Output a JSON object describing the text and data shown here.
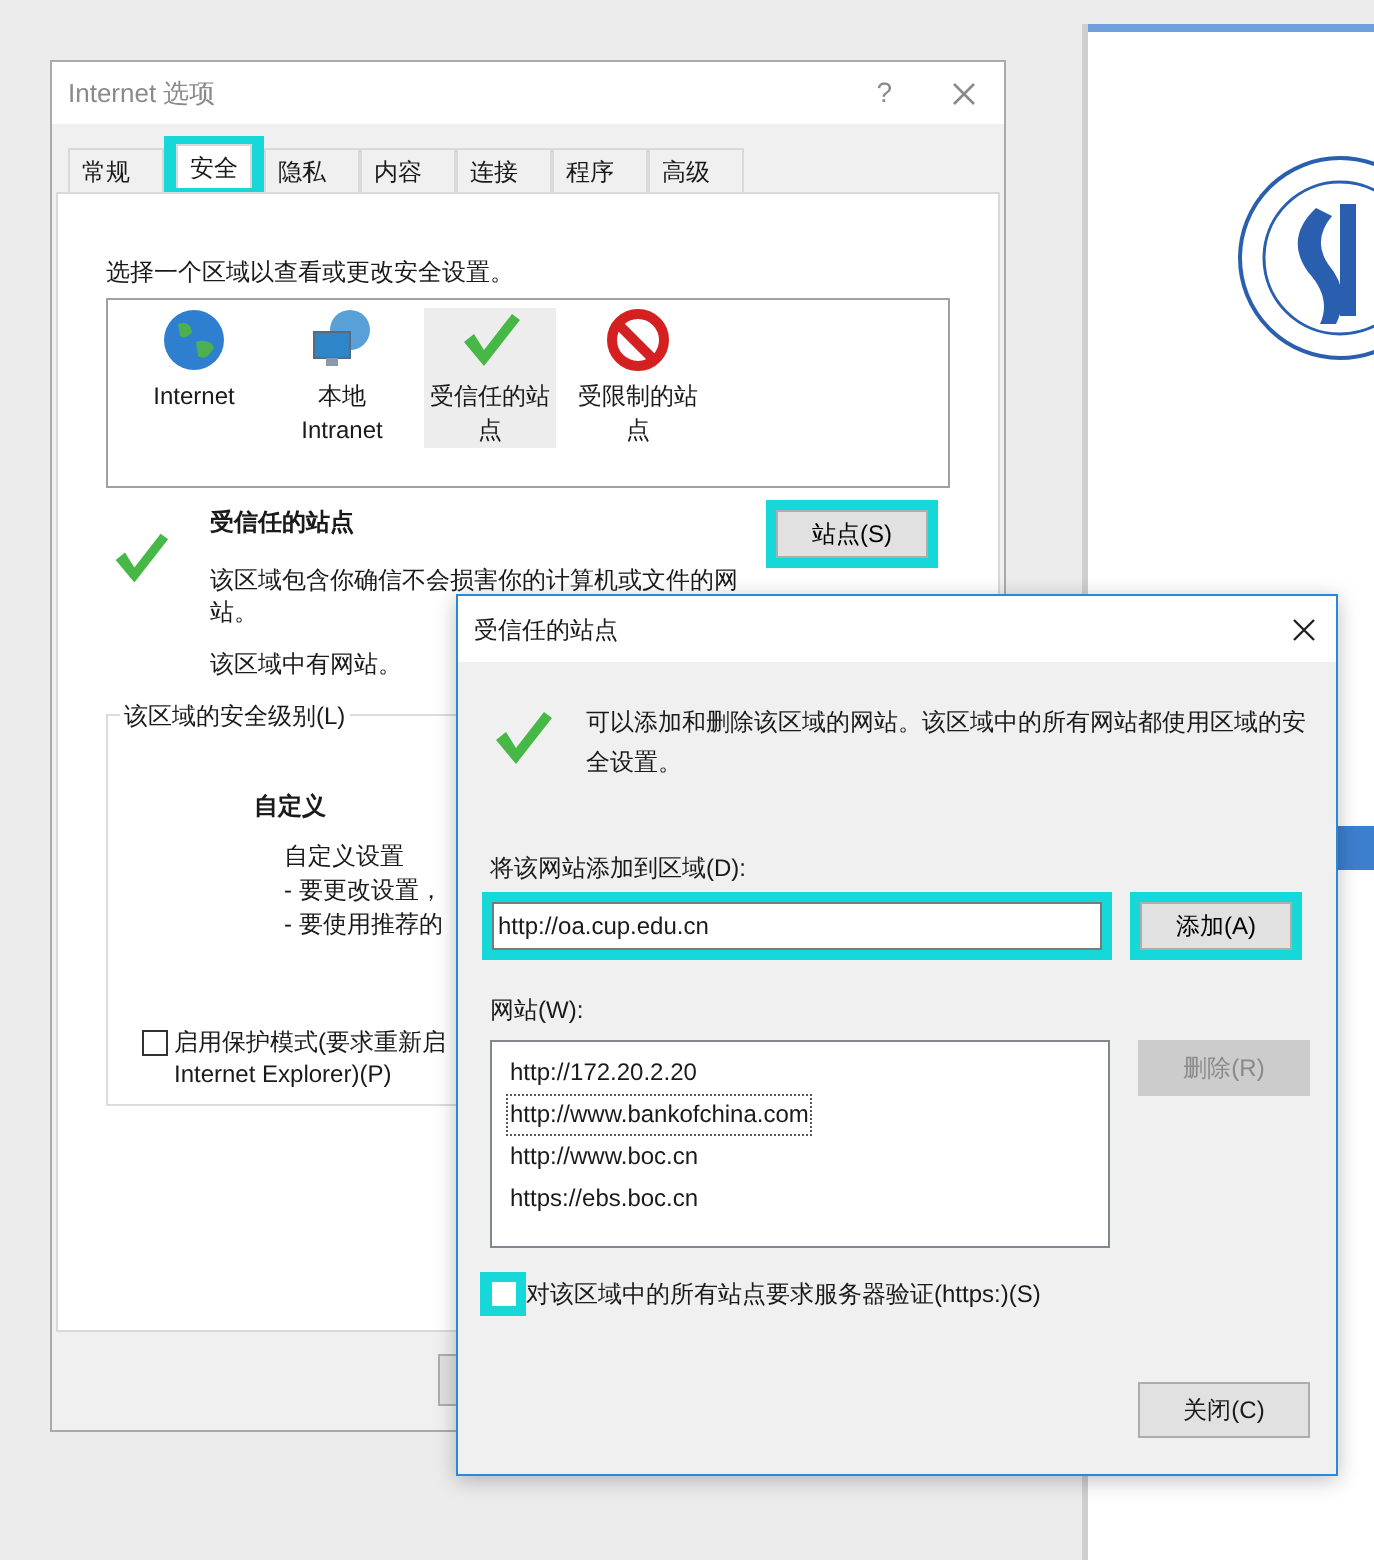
{
  "main_dialog": {
    "title": "Internet 选项",
    "help": "?",
    "tabs": [
      {
        "label": "常规",
        "selected": false,
        "highlighted": false
      },
      {
        "label": "安全",
        "selected": true,
        "highlighted": true
      },
      {
        "label": "隐私",
        "selected": false,
        "highlighted": false
      },
      {
        "label": "内容",
        "selected": false,
        "highlighted": false
      },
      {
        "label": "连接",
        "selected": false,
        "highlighted": false
      },
      {
        "label": "程序",
        "selected": false,
        "highlighted": false
      },
      {
        "label": "高级",
        "selected": false,
        "highlighted": false
      }
    ],
    "zone_prompt": "选择一个区域以查看或更改安全设置。",
    "zones": [
      {
        "label": "Internet",
        "kind": "globe",
        "selected": false
      },
      {
        "label": "本地 Intranet",
        "kind": "intranet",
        "selected": false
      },
      {
        "label": "受信任的站点",
        "kind": "check",
        "selected": true
      },
      {
        "label": "受限制的站点",
        "kind": "blocked",
        "selected": false
      }
    ],
    "zone_detail": {
      "title": "受信任的站点",
      "description": "该区域包含你确信不会损害你的计算机或文件的网站。",
      "status": "该区域中有网站。"
    },
    "sites_button": {
      "label": "站点(S)",
      "highlighted": true
    },
    "level_group": {
      "legend": "该区域的安全级别(L)",
      "level_name": "自定义",
      "lines": [
        "自定义设置",
        "- 要更改设置，",
        "- 要使用推荐的"
      ]
    },
    "protected_mode": {
      "lines": [
        "启用保护模式(要求重新启",
        "Internet Explorer)(P)"
      ],
      "checked": false
    }
  },
  "trusted_dialog": {
    "title": "受信任的站点",
    "info": "可以添加和删除该区域的网站。该区域中的所有网站都使用区域的安全设置。",
    "add_label": "将该网站添加到区域(D):",
    "url_value": "http://oa.cup.edu.cn",
    "url_highlighted": true,
    "add_button": {
      "label": "添加(A)",
      "highlighted": true
    },
    "list_label": "网站(W):",
    "sites": [
      {
        "url": "http://172.20.2.20",
        "focused": false
      },
      {
        "url": "http://www.bankofchina.com",
        "focused": true
      },
      {
        "url": "http://www.boc.cn",
        "focused": false
      },
      {
        "url": "https://ebs.boc.cn",
        "focused": false
      }
    ],
    "remove_button": {
      "label": "删除(R)",
      "disabled": true
    },
    "https_check": {
      "label": "对该区域中的所有站点要求服务器验证(https:)(S)",
      "checked": false,
      "highlighted": true
    },
    "close_button": {
      "label": "关闭(C)"
    }
  }
}
